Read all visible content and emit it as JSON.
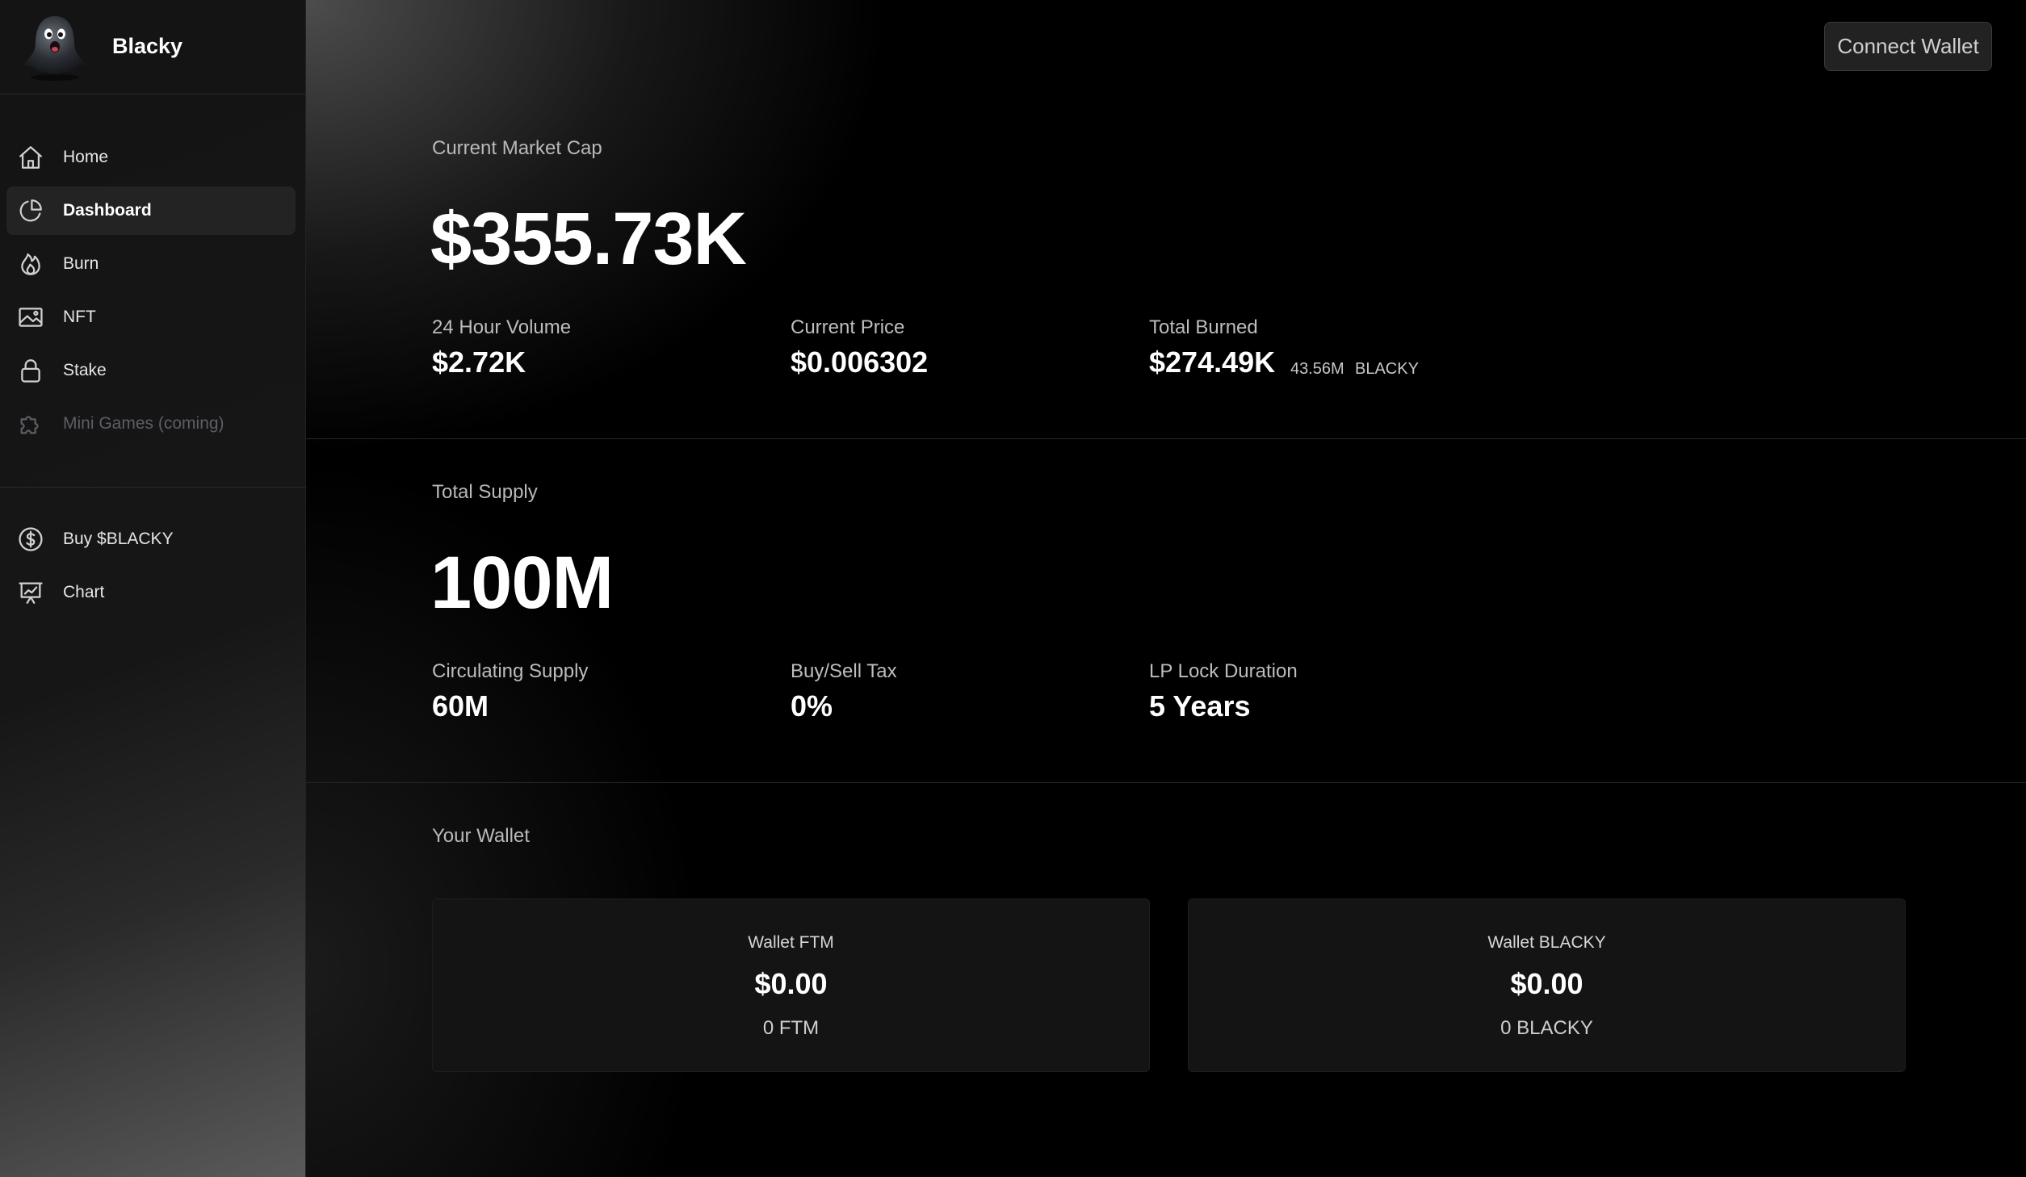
{
  "brand": {
    "name": "Blacky",
    "logo_icon": "ghost-logo-icon"
  },
  "sidebar": {
    "items": [
      {
        "label": "Home",
        "icon": "home-icon",
        "active": false,
        "disabled": false
      },
      {
        "label": "Dashboard",
        "icon": "pie-chart-icon",
        "active": true,
        "disabled": false
      },
      {
        "label": "Burn",
        "icon": "flame-icon",
        "active": false,
        "disabled": false
      },
      {
        "label": "NFT",
        "icon": "image-icon",
        "active": false,
        "disabled": false
      },
      {
        "label": "Stake",
        "icon": "lock-icon",
        "active": false,
        "disabled": false
      },
      {
        "label": "Mini Games (coming)",
        "icon": "puzzle-icon",
        "active": false,
        "disabled": true
      }
    ],
    "links": [
      {
        "label": "Buy $BLACKY",
        "icon": "dollar-circle-icon"
      },
      {
        "label": "Chart",
        "icon": "presentation-chart-icon"
      }
    ]
  },
  "header": {
    "connect_label": "Connect Wallet"
  },
  "market": {
    "label": "Current Market Cap",
    "value": "$355.73K",
    "stats": [
      {
        "label": "24 Hour Volume",
        "value": "$2.72K"
      },
      {
        "label": "Current Price",
        "value": "$0.006302"
      },
      {
        "label": "Total Burned",
        "value": "$274.49K",
        "sub_amount": "43.56M",
        "sub_unit": "BLACKY"
      }
    ]
  },
  "supply": {
    "label": "Total Supply",
    "value": "100M",
    "stats": [
      {
        "label": "Circulating Supply",
        "value": "60M"
      },
      {
        "label": "Buy/Sell Tax",
        "value": "0%"
      },
      {
        "label": "LP Lock Duration",
        "value": "5 Years"
      }
    ]
  },
  "wallet": {
    "label": "Your Wallet",
    "cards": [
      {
        "label": "Wallet FTM",
        "value": "$0.00",
        "amount": "0 FTM"
      },
      {
        "label": "Wallet BLACKY",
        "value": "$0.00",
        "amount": "0 BLACKY"
      }
    ]
  },
  "colors": {
    "background": "#000000",
    "sidebar_active": "#232323",
    "card": "#141414",
    "disabled_text": "#5d5d66"
  }
}
